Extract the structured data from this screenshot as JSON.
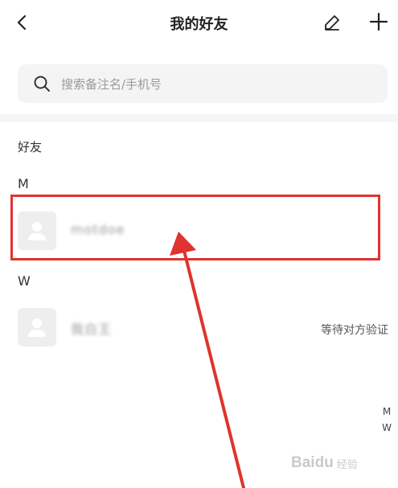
{
  "header": {
    "title": "我的好友",
    "back_icon": "chevron-left-icon",
    "edit_icon": "edit-icon",
    "add_icon": "plus-icon"
  },
  "search": {
    "placeholder": "搜索备注名/手机号",
    "icon": "search-icon"
  },
  "friends_section": {
    "label": "好友",
    "groups": [
      {
        "letter": "M",
        "items": [
          {
            "name": "motdoe",
            "status": ""
          }
        ]
      },
      {
        "letter": "W",
        "items": [
          {
            "name": "我白王",
            "status": "等待对方验证"
          }
        ]
      }
    ]
  },
  "index_bar": [
    "M",
    "W"
  ],
  "annotation": {
    "highlight_color": "#e0332f",
    "arrow_color": "#e0332f"
  },
  "watermark": {
    "text": "Baidu",
    "sub": "经验"
  }
}
